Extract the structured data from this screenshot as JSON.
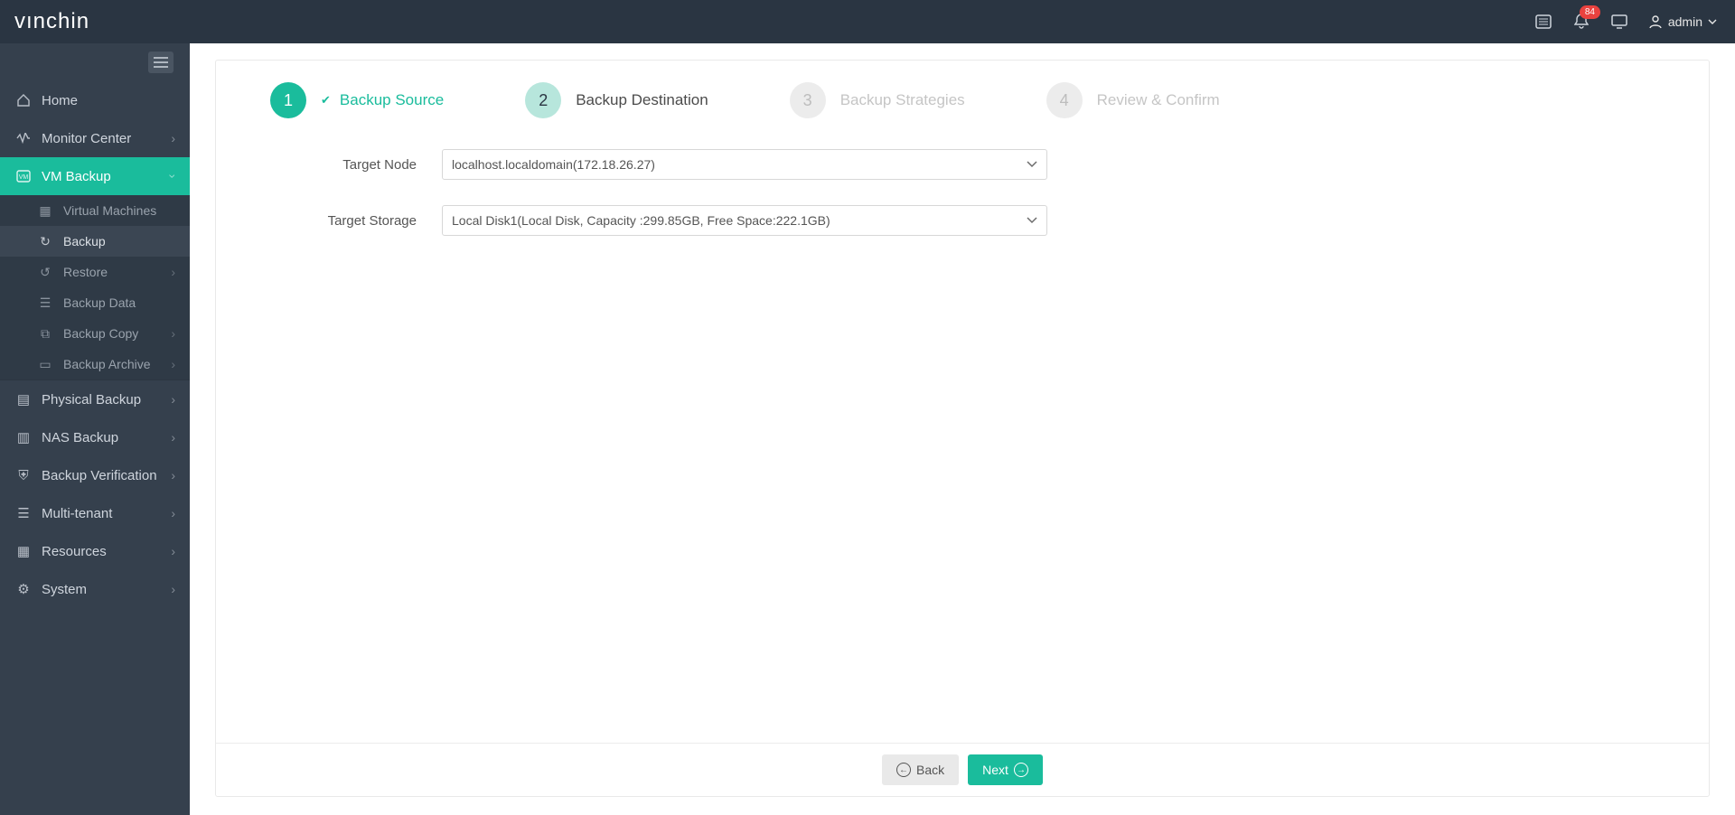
{
  "brand": {
    "part1": "vın",
    "part2": "chin"
  },
  "header": {
    "badge_count": "84",
    "user_label": "admin"
  },
  "sidebar": {
    "items": [
      {
        "label": "Home",
        "icon": "home-icon"
      },
      {
        "label": "Monitor Center",
        "icon": "monitor-icon",
        "expandable": true
      },
      {
        "label": "VM Backup",
        "icon": "vm-icon",
        "active": true,
        "expandable": true
      }
    ],
    "vm_sub": [
      {
        "label": "Virtual Machines",
        "icon": "grid-icon"
      },
      {
        "label": "Backup",
        "icon": "refresh-icon",
        "selected": true
      },
      {
        "label": "Restore",
        "icon": "undo-icon",
        "expandable": true
      },
      {
        "label": "Backup Data",
        "icon": "stack-icon"
      },
      {
        "label": "Backup Copy",
        "icon": "copy-icon",
        "expandable": true
      },
      {
        "label": "Backup Archive",
        "icon": "archive-icon",
        "expandable": true
      }
    ],
    "rest": [
      {
        "label": "Physical Backup",
        "icon": "server-icon",
        "expandable": true
      },
      {
        "label": "NAS Backup",
        "icon": "nas-icon",
        "expandable": true
      },
      {
        "label": "Backup Verification",
        "icon": "shield-icon",
        "expandable": true
      },
      {
        "label": "Multi-tenant",
        "icon": "list-icon",
        "expandable": true
      },
      {
        "label": "Resources",
        "icon": "grid4-icon",
        "expandable": true
      },
      {
        "label": "System",
        "icon": "gear-icon",
        "expandable": true
      }
    ]
  },
  "wizard": {
    "steps": [
      {
        "num": "1",
        "label": "Backup Source"
      },
      {
        "num": "2",
        "label": "Backup Destination"
      },
      {
        "num": "3",
        "label": "Backup Strategies"
      },
      {
        "num": "4",
        "label": "Review & Confirm"
      }
    ]
  },
  "form": {
    "target_node_label": "Target Node",
    "target_node_value": "localhost.localdomain(172.18.26.27)",
    "target_storage_label": "Target Storage",
    "target_storage_value": "Local Disk1(Local Disk, Capacity :299.85GB, Free Space:222.1GB)"
  },
  "buttons": {
    "back": "Back",
    "next": "Next"
  }
}
